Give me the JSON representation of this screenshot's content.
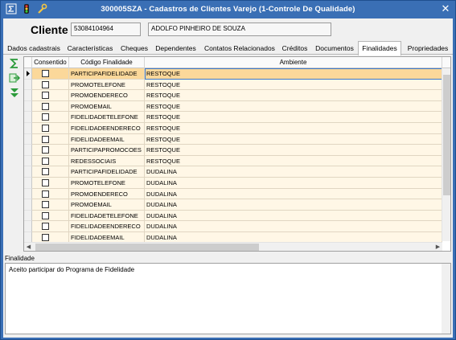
{
  "window": {
    "title": "300005SZA - Cadastros de Clientes Varejo (1-Controle De Qualidade)",
    "close_glyph": "✕",
    "titlebar_color": "#3a6fb5"
  },
  "cliente": {
    "label": "Cliente",
    "codigo": "53084104964",
    "nome": "ADOLFO PINHEIRO DE SOUZA"
  },
  "tabs": [
    {
      "label": "Dados cadastrais",
      "active": false
    },
    {
      "label": "Características",
      "active": false
    },
    {
      "label": "Cheques",
      "active": false
    },
    {
      "label": "Dependentes",
      "active": false
    },
    {
      "label": "Contatos Relacionados",
      "active": false
    },
    {
      "label": "Créditos",
      "active": false
    },
    {
      "label": "Documentos",
      "active": false
    },
    {
      "label": "Finalidades",
      "active": true
    },
    {
      "label": "Propriedades",
      "active": false
    }
  ],
  "tools": [
    "sum-icon",
    "export-icon",
    "expand-icon"
  ],
  "grid": {
    "columns": [
      "Consentido",
      "Código Finalidade",
      "Ambiente"
    ],
    "rows": [
      {
        "codigo": "PARTICIPAFIDELIDADE",
        "ambiente": "RESTOQUE",
        "selected": true
      },
      {
        "codigo": "PROMOTELEFONE",
        "ambiente": "RESTOQUE"
      },
      {
        "codigo": "PROMOENDERECO",
        "ambiente": "RESTOQUE"
      },
      {
        "codigo": "PROMOEMAIL",
        "ambiente": "RESTOQUE"
      },
      {
        "codigo": "FIDELIDADETELEFONE",
        "ambiente": "RESTOQUE"
      },
      {
        "codigo": "FIDELIDADEENDERECO",
        "ambiente": "RESTOQUE"
      },
      {
        "codigo": "FIDELIDADEEMAIL",
        "ambiente": "RESTOQUE"
      },
      {
        "codigo": "PARTICIPAPROMOCOES",
        "ambiente": "RESTOQUE"
      },
      {
        "codigo": "REDESSOCIAIS",
        "ambiente": "RESTOQUE"
      },
      {
        "codigo": "PARTICIPAFIDELIDADE",
        "ambiente": "DUDALINA"
      },
      {
        "codigo": "PROMOTELEFONE",
        "ambiente": "DUDALINA"
      },
      {
        "codigo": "PROMOENDERECO",
        "ambiente": "DUDALINA"
      },
      {
        "codigo": "PROMOEMAIL",
        "ambiente": "DUDALINA"
      },
      {
        "codigo": "FIDELIDADETELEFONE",
        "ambiente": "DUDALINA"
      },
      {
        "codigo": "FIDELIDADEENDERECO",
        "ambiente": "DUDALINA"
      },
      {
        "codigo": "FIDELIDADEEMAIL",
        "ambiente": "DUDALINA"
      }
    ]
  },
  "finalidade": {
    "label": "Finalidade",
    "text": "Aceito participar do Programa de Fidelidade"
  }
}
